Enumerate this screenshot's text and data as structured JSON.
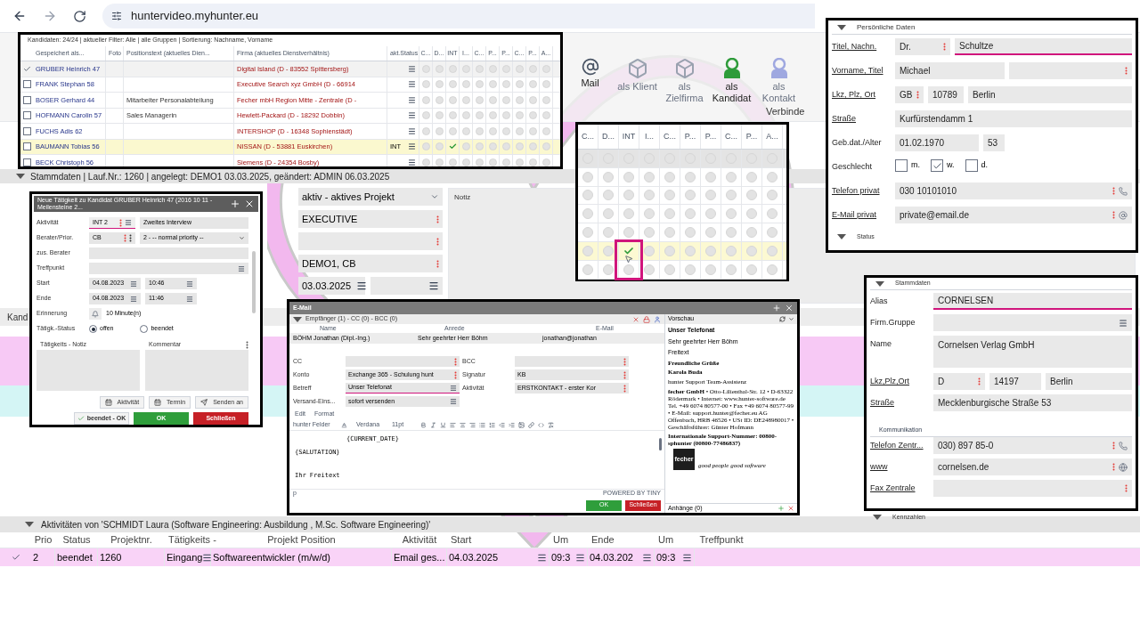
{
  "browser": {
    "url": "huntervideo.myhunter.eu"
  },
  "ribbon": {
    "items": [
      {
        "label": "Mail",
        "kind": "mail",
        "disabled": false
      },
      {
        "label": "als Klient",
        "kind": "cube",
        "disabled": true
      },
      {
        "label": "als Zielfirma",
        "kind": "cube",
        "disabled": true
      },
      {
        "label": "als Kandidat",
        "kind": "person",
        "disabled": false
      },
      {
        "label": "als Kontakt",
        "kind": "person",
        "disabled": true
      }
    ],
    "group": "Verbinde"
  },
  "project": {
    "header": "Stammdaten | Lauf.Nr.: 1260 | angelegt: DEMO1 03.03.2025, geändert: ADMIN 06.03.2025",
    "fields": [
      {
        "value": "aktiv - aktives Projekt",
        "kind": "select"
      },
      {
        "value": "EXECUTIVE",
        "kind": "menu"
      },
      {
        "kind": "menu"
      },
      {
        "value": "DEMO1, CB",
        "kind": "menu"
      },
      {
        "value": "03.03.2025",
        "kind": "date"
      }
    ],
    "note_title": "Notiz"
  },
  "candidate_grid": {
    "tab": "Kand",
    "rows": [
      {
        "color": "#f7c9f5"
      },
      {
        "color": "#d4f5f5"
      }
    ]
  },
  "candidates": {
    "summary": "Kandidaten: 24/24 | aktueller Filter: Alle | alle Gruppen | Sortierung: Nachname, Vorname",
    "columns": [
      {
        "label": "Gespeichert als...",
        "kind": "name"
      },
      {
        "label": "Foto",
        "kind": "photo"
      },
      {
        "label": "Positionstext (aktuelles Dien...",
        "kind": "position"
      },
      {
        "label": "Firma (aktuelles Dienstverhältnis)",
        "kind": "company"
      },
      {
        "label": "akt.Status",
        "kind": "status"
      },
      {
        "label": "C...",
        "kind": "flag"
      },
      {
        "label": "D...",
        "kind": "flag"
      },
      {
        "label": "INT",
        "kind": "int"
      },
      {
        "label": "I...",
        "kind": "flag"
      },
      {
        "label": "C...",
        "kind": "flag"
      },
      {
        "label": "P...",
        "kind": "flag"
      },
      {
        "label": "P...",
        "kind": "flag"
      },
      {
        "label": "C...",
        "kind": "flag"
      },
      {
        "label": "P...",
        "kind": "flag"
      },
      {
        "label": "A...",
        "kind": "flag"
      }
    ],
    "rows": [
      {
        "name": "GRUBER Heinrich 47",
        "company": "Digital Island (D - 83552 Spittersberg)",
        "selected": true,
        "highlighted": false,
        "int_checked": false
      },
      {
        "name": "FRANK Stephan 58",
        "company": "Executive Search xyz GmbH (D - 66914",
        "selected": false,
        "highlighted": false,
        "int_checked": false
      },
      {
        "name": "BOSER Gerhard 44",
        "position": "Mitarbeiter Personalabteilung",
        "company": "Fecher mbH Region Mitte - Zentrale (D -",
        "selected": false,
        "highlighted": false,
        "int_checked": false
      },
      {
        "name": "HOFMANN Carolin 57",
        "position": "Sales Managerin",
        "company": "Hewlett-Packard (D - 18292 Dobbin)",
        "selected": false,
        "highlighted": false,
        "int_checked": false
      },
      {
        "name": "FUCHS Adis 62",
        "company": "INTERSHOP (D - 16348 Sophienstädt)",
        "selected": false,
        "highlighted": false,
        "int_checked": false
      },
      {
        "name": "BAUMANN Tobias 56",
        "company": "NISSAN (D - 53881 Euskirchen)",
        "status": "INT",
        "selected": false,
        "highlighted": true,
        "int_checked": true
      },
      {
        "name": "BECK Christoph 56",
        "company": "Siemens (D - 24354 Bosby)",
        "selected": false,
        "highlighted": false,
        "int_checked": false
      }
    ]
  },
  "grid_zoom": {
    "columns": [
      {
        "label": "C...",
        "kind": "flag"
      },
      {
        "label": "D...",
        "kind": "flag"
      },
      {
        "label": "INT",
        "kind": "int"
      },
      {
        "label": "I...",
        "kind": "flag"
      },
      {
        "label": "C...",
        "kind": "flag"
      },
      {
        "label": "P...",
        "kind": "flag"
      },
      {
        "label": "P...",
        "kind": "flag"
      },
      {
        "label": "C...",
        "kind": "flag"
      },
      {
        "label": "P...",
        "kind": "flag"
      },
      {
        "label": "A...",
        "kind": "flag"
      }
    ],
    "rows": [
      {
        "selected": true,
        "highlighted": false,
        "int_checked": false
      },
      {
        "selected": false,
        "highlighted": false,
        "int_checked": false
      },
      {
        "selected": false,
        "highlighted": false,
        "int_checked": false
      },
      {
        "selected": false,
        "highlighted": false,
        "int_checked": false
      },
      {
        "selected": false,
        "highlighted": false,
        "int_checked": false
      },
      {
        "selected": false,
        "highlighted": true,
        "int_checked": true
      },
      {
        "selected": false,
        "highlighted": false,
        "int_checked": false
      }
    ]
  },
  "personal": {
    "title": "Persönliche Daten",
    "footer": "Status",
    "rows": [
      {
        "kind": "name",
        "label": "Titel, Nachn.",
        "link": true,
        "fields": [
          {
            "value": "Dr.",
            "menu": true,
            "focused": false
          },
          {
            "value": "Schultze",
            "menu": false,
            "focused": true
          }
        ]
      },
      {
        "kind": "pair",
        "label": "Vorname, Titel",
        "link": true,
        "fields": [
          {
            "value": "Michael",
            "menu": false,
            "focused": false
          },
          {
            "menu": true,
            "focused": false
          }
        ]
      },
      {
        "kind": "address",
        "label": "Lkz, Plz, Ort",
        "link": true,
        "fields": [
          {
            "value": "GB",
            "menu": true,
            "focused": false
          },
          {
            "value": "10789",
            "menu": false,
            "focused": false
          },
          {
            "value": "Berlin",
            "menu": false,
            "focused": false
          }
        ]
      },
      {
        "kind": "single",
        "label": "Straße",
        "link": true,
        "fields": [
          {
            "value": "Kurfürstendamm 1",
            "menu": false,
            "focused": false
          }
        ]
      },
      {
        "kind": "date-age",
        "label": "Geb.dat./Alter",
        "link": false,
        "fields": [
          {
            "value": "01.02.1970",
            "menu": false,
            "focused": false
          },
          {
            "value": "53",
            "menu": false,
            "focused": false
          }
        ]
      },
      {
        "kind": "checkboxes",
        "label": "Geschlecht",
        "link": false,
        "options": [
          {
            "label": "m.",
            "checked": false
          },
          {
            "label": "w.",
            "checked": true
          },
          {
            "label": "d.",
            "checked": false
          }
        ]
      },
      {
        "kind": "single",
        "label": "Telefon privat",
        "link": true,
        "fields": [
          {
            "value": "030 10101010",
            "menu": true,
            "focused": false,
            "kind": "phone"
          }
        ]
      },
      {
        "kind": "single",
        "label": "E-Mail privat",
        "link": true,
        "fields": [
          {
            "value": "private@email.de",
            "menu": true,
            "focused": false,
            "kind": "email"
          }
        ]
      }
    ]
  },
  "company": {
    "title": "Stammdaten",
    "footer": "Kennzahlen",
    "rows": [
      {
        "kind": "single",
        "label": "Alias",
        "link": false,
        "fields": [
          {
            "value": "CORNELSEN",
            "menu": false,
            "focused": true
          }
        ]
      },
      {
        "kind": "single",
        "label": "Firm.Gruppe",
        "link": false,
        "fields": [
          {
            "menu": false,
            "focused": false,
            "kind": "list"
          }
        ]
      },
      {
        "kind": "multiline",
        "label": "Name",
        "link": false,
        "fields": [
          {
            "value": "Cornelsen Verlag GmbH",
            "menu": false,
            "focused": false
          }
        ]
      },
      {
        "kind": "address",
        "label": "Lkz,Plz,Ort",
        "link": true,
        "fields": [
          {
            "value": "D",
            "menu": true,
            "focused": false
          },
          {
            "value": "14197",
            "menu": false,
            "focused": false
          },
          {
            "value": "Berlin",
            "menu": false,
            "focused": false
          }
        ]
      },
      {
        "kind": "single",
        "label": "Straße",
        "link": true,
        "fields": [
          {
            "value": "Mecklenburgische Straße 53",
            "menu": false,
            "focused": false
          }
        ]
      },
      {
        "kind": "section",
        "label": "Kommunikation"
      },
      {
        "kind": "single",
        "label": "Telefon Zentr...",
        "link": true,
        "fields": [
          {
            "value": "030) 897 85-0",
            "menu": true,
            "focused": false,
            "kind": "phone"
          }
        ]
      },
      {
        "kind": "single",
        "label": "www",
        "link": true,
        "fields": [
          {
            "value": "cornelsen.de",
            "menu": true,
            "focused": false,
            "kind": "web"
          }
        ]
      },
      {
        "kind": "single",
        "label": "Fax Zentrale",
        "link": true,
        "fields": [
          {
            "menu": true,
            "focused": false
          }
        ]
      }
    ]
  },
  "activity_dialog": {
    "title": "Neue Tätigkeit zu Kandidat GRUBER Heinrich 47 (2016 10 11 - Meilensteine 2...",
    "rows": [
      {
        "kind": "code",
        "label": "Aktivität",
        "fields": [
          {
            "value": "INT 2",
            "focused": true
          },
          {
            "value": "Zweites Interview",
            "focused": false
          }
        ]
      },
      {
        "kind": "priority",
        "label": "Berater/Prior.",
        "fields": [
          {
            "value": "CB",
            "focused": false
          },
          {
            "value": "2 - -- normal priority --",
            "focused": false
          }
        ]
      },
      {
        "kind": "single",
        "label": "zus. Berater"
      },
      {
        "kind": "list",
        "label": "Treffpunkt"
      },
      {
        "kind": "datetime",
        "label": "Start",
        "fields": [
          {
            "value": "04.08.2023",
            "focused": false
          },
          {
            "value": "10:46",
            "focused": false
          }
        ]
      },
      {
        "kind": "datetime",
        "label": "Ende",
        "fields": [
          {
            "value": "04.08.2023",
            "focused": false
          },
          {
            "value": "11:46",
            "focused": false
          }
        ]
      },
      {
        "kind": "reminder",
        "label": "Erinnerung",
        "fields": [
          {
            "value": "10 Minute(n)",
            "focused": false
          }
        ]
      },
      {
        "kind": "radios",
        "label": "Tätigk.-Status",
        "options": [
          {
            "label": "offen",
            "selected": true
          },
          {
            "label": "beendet",
            "selected": false
          }
        ]
      }
    ],
    "note_labels": [
      "Tätigkeits - Notiz",
      "Kommentar"
    ],
    "actions": [
      {
        "label": "Aktivität",
        "kind": "calendar"
      },
      {
        "label": "Termin",
        "kind": "calendar"
      },
      {
        "label": "Senden an",
        "kind": "send"
      }
    ],
    "buttons": [
      {
        "label": "beendet - OK",
        "kind": "check"
      },
      {
        "label": "OK",
        "kind": "ok"
      },
      {
        "label": "Schließen",
        "kind": "close"
      }
    ]
  },
  "email": {
    "title": "E-Mail",
    "recipients_label": "Empfänger (1) - CC (0) - BCC (0)",
    "columns": [
      "Name",
      "Anrede",
      "E-Mail"
    ],
    "recipients": [
      {
        "name": "BÖHM Jonathan (Dipl.-Ing.)",
        "salutation": "Sehr geehrter Herr Böhm",
        "email": "jonathan@jonathan"
      }
    ],
    "fields": [
      {
        "label": "CC",
        "kind": "menu",
        "focused": false
      },
      {
        "label": "BCC",
        "kind": "menu",
        "focused": false
      },
      {
        "label": "Konto",
        "value": "Exchange 365 - Schulung hunt",
        "kind": "menu",
        "focused": false
      },
      {
        "label": "Signatur",
        "value": "KB",
        "kind": "menu",
        "focused": false
      },
      {
        "label": "Betreff",
        "value": "Unser Telefonat",
        "kind": "list",
        "focused": true
      },
      {
        "label": "Aktivität",
        "value": "ERSTKONTAKT - erster Kor",
        "kind": "menu",
        "focused": false
      },
      {
        "label": "Versand-Eins...",
        "value": "sofort versenden",
        "kind": "list",
        "focused": false
      }
    ],
    "menus": [
      "Edit",
      "Format"
    ],
    "toolbar": {
      "fields": "hunter Felder",
      "font": "Verdana",
      "size": "11pt"
    },
    "body": [
      {
        "text": "{CURRENT_DATE}",
        "kind": "indented"
      },
      {
        "text": "{SALUTATION}",
        "kind": "plain"
      },
      {
        "text": "Ihr Freitext",
        "kind": "gap"
      }
    ],
    "status_path": "p",
    "powered": "POWERED BY TINY",
    "buttons": [
      {
        "label": "OK",
        "kind": "ok"
      },
      {
        "label": "Schließen",
        "kind": "close"
      }
    ],
    "preview": {
      "title": "Vorschau",
      "subject": "Unser Telefonat",
      "lines": [
        {
          "text": "Sehr geehrter Herr Böhm",
          "kind": "plain"
        },
        {
          "text": "Freitext",
          "kind": "plain"
        },
        {
          "text": "Freundliche Grüße",
          "kind": "strong"
        },
        {
          "text": "Karola Buda",
          "kind": "strong"
        },
        {
          "text": "hunter Support Team-Assistenz",
          "kind": "serif"
        },
        {
          "text": "**fecher GmbH** • Otto-Lilienthal-Str. 12 • D-63322 Rödermark • Internet: www.hunter-software.de Tel. +49 6074 80577-00 • Fax +49 6074 80577-99 • E-Mail: support.hunter@fecher.eu AG Offenbach, HRB 46526 • USt ID: DE248980017 • Geschäftsführer: Günter Hofmann",
          "kind": "small"
        },
        {
          "text": "Internationale Support-Nummer: 00800-sphunter (00800-77486837)",
          "kind": "strong"
        }
      ],
      "logo": {
        "name": "fecher",
        "tagline": "good people good software"
      },
      "attachments": "Anhänge (0)"
    }
  },
  "activities": {
    "title": "Aktivitäten von 'SCHMIDT Laura (Software Engineering: Ausbildung , M.Sc. Software Engineering)'",
    "columns": [
      {
        "label": "Prio",
        "kind": "text"
      },
      {
        "label": "Status",
        "kind": "text"
      },
      {
        "label": "Projektnr.",
        "kind": "text"
      },
      {
        "label": "Tätigkeits -",
        "kind": "list"
      },
      {
        "label": "Projekt Position",
        "kind": "text"
      },
      {
        "label": "Aktivität",
        "kind": "text"
      },
      {
        "label": "Start",
        "kind": "list"
      },
      {
        "label": "Um",
        "kind": "list"
      },
      {
        "label": "Ende",
        "kind": "list"
      },
      {
        "label": "Um",
        "kind": "list"
      },
      {
        "label": "Treffpunkt",
        "kind": "text"
      }
    ],
    "rows": [
      {
        "selected": true,
        "cells": [
          "2",
          "beendet",
          "1260",
          "Eingang",
          "Softwareentwickler (m/w/d)",
          "Email ges...",
          "04.03.2025",
          "09:3",
          "04.03.202",
          "09:3"
        ]
      }
    ]
  }
}
